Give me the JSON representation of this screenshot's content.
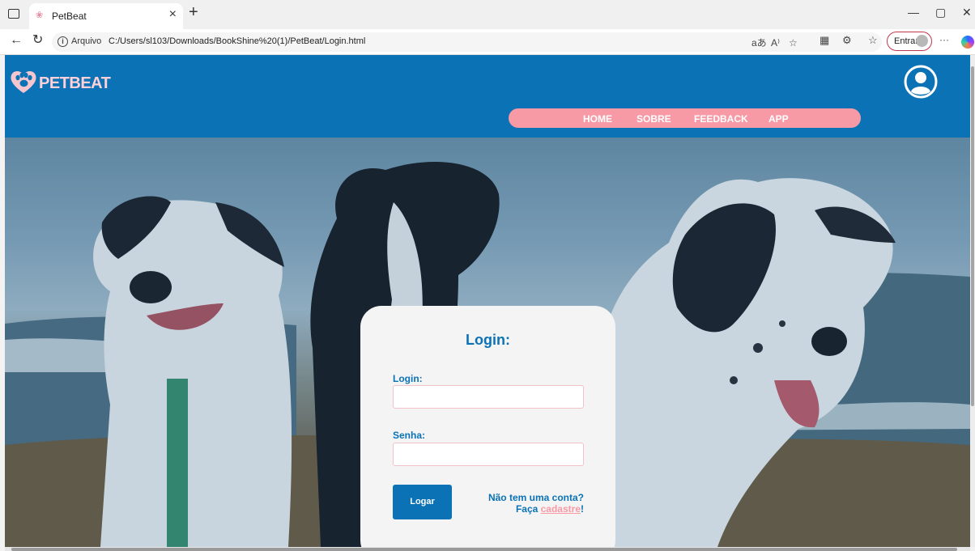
{
  "browser": {
    "tab_title": "PetBeat",
    "tab_close": "×",
    "new_tab": "+",
    "url_label": "Arquivo",
    "url": "C:/Users/sl103/Downloads/BookShine%20(1)/PetBeat/Login.html",
    "sign_in_label": "Entrar",
    "more": "···"
  },
  "header": {
    "logo_text": "PETBEAT"
  },
  "nav": {
    "items": [
      "HOME",
      "SOBRE",
      "FEEDBACK",
      "APP"
    ]
  },
  "login": {
    "title": "Login:",
    "login_label": "Login:",
    "password_label": "Senha:",
    "submit_label": "Logar",
    "no_account": "Não tem uma conta?",
    "signup_prefix": "Faça ",
    "signup_link": "cadastre",
    "signup_suffix": "!"
  },
  "colors": {
    "header_bg": "#0a72b5",
    "nav_pill": "#f79aa5",
    "card_bg": "#f4f4f4",
    "accent_blue": "#0a72b5",
    "accent_pink": "#f79aa5"
  }
}
